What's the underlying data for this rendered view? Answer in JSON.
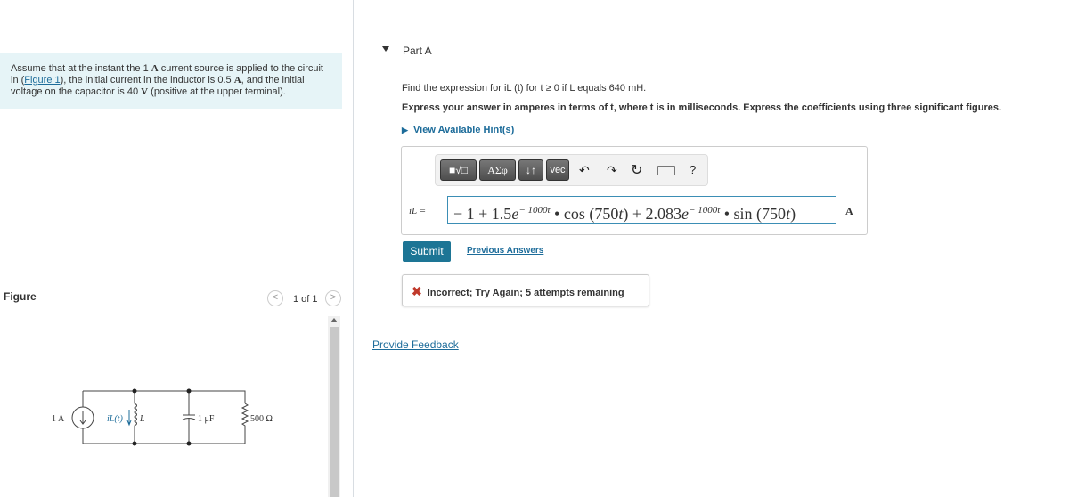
{
  "problem": {
    "intro_prefix": "Assume that at the instant the 1 ",
    "unit_A": "A",
    "intro_mid": " current source is applied to the circuit in (",
    "figure_link": "Figure 1",
    "intro_after_link": "), the initial current in the inductor is 0.5 ",
    "intro_mid2": ", and the initial voltage on the capacitor is 40 ",
    "unit_V": "V",
    "intro_end": " (positive at the upper terminal)."
  },
  "figure": {
    "label": "Figure",
    "pager": "1 of 1",
    "labels": {
      "source": "1 A",
      "current": "iL(t)",
      "inductor": "L",
      "capacitor": "1 μF",
      "resistor": "500 Ω"
    }
  },
  "part": {
    "title": "Part A",
    "question": "Find the expression for iL (t) for t ≥ 0 if L equals 640 mH.",
    "instructions": "Express your answer in amperes in terms of t, where t is in milliseconds. Express the coefficients using three significant figures.",
    "hints_label": "View Available Hint(s)"
  },
  "toolbar": {
    "templates": "■√□",
    "greek": "ΑΣφ",
    "arrows": "↓↑",
    "vec": "vec",
    "undo": "↶",
    "redo": "↷",
    "reset": "↻",
    "help": "?"
  },
  "answer": {
    "label": "iL =",
    "value": "− 1 + 1.5e^−1000t • cos (750t) + 2.083e^−1000t • sin (750t)",
    "parts": {
      "a": "− 1 + 1.5",
      "e": "e",
      "exp": "− 1000t",
      "b": " •  cos (750",
      "t": "t",
      "c": ") + 2.083",
      "d": " •  sin (750",
      "end": ")"
    },
    "unit": "A"
  },
  "submit_label": "Submit",
  "previous_answers_label": "Previous Answers",
  "feedback": {
    "text": "Incorrect; Try Again; 5 attempts remaining",
    "color": "#c0392b"
  },
  "provide_feedback_label": "Provide Feedback"
}
